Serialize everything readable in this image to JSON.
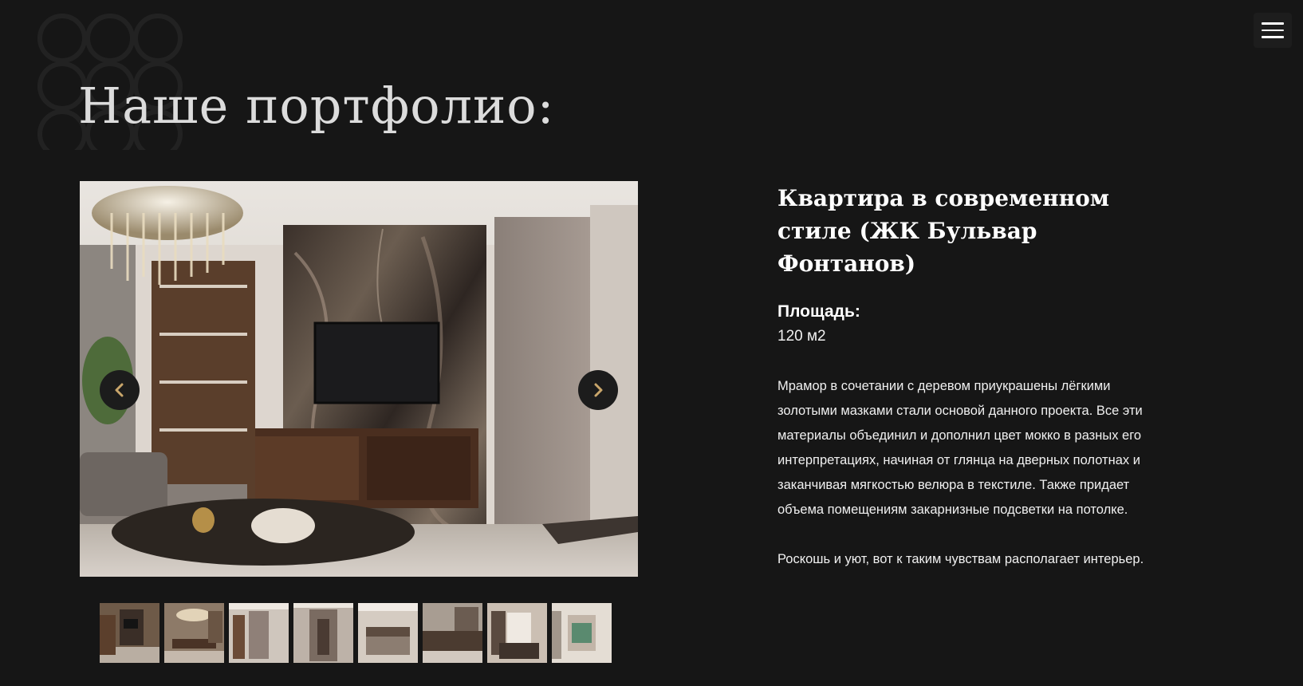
{
  "header": {
    "menu_icon": "hamburger-menu-icon"
  },
  "page_title": "Наше портфолио:",
  "gallery": {
    "prev_icon": "chevron-left-icon",
    "next_icon": "chevron-right-icon",
    "main_image": "living-room-marble-wall-photo",
    "thumbnails": [
      "living-room-photo",
      "dining-room-photo",
      "hallway-photo",
      "corridor-photo",
      "bedroom-photo",
      "kitchen-photo",
      "bedroom-window-photo",
      "bathroom-photo"
    ]
  },
  "project": {
    "title": "Квартира в современном стиле (ЖК Бульвар Фонтанов)",
    "area_label": "Площадь:",
    "area_value": "120 м2",
    "description_1": "Мрамор в сочетании с деревом приукрашены лёгкими золотыми мазками стали основой данного проекта. Все эти материалы объединил и дополнил цвет мокко в разных его интерпретациях, начиная от глянца на дверных полотнах и заканчивая мягкостью велюра в текстиле. Также придает объема помещениям закарнизные подсветки на потолке.",
    "description_2": "Роскошь и уют, вот к таким чувствам располагает интерьер."
  },
  "colors": {
    "background": "#161616",
    "text": "#ffffff",
    "title": "#dcdcdc",
    "arrow_bg": "#1c1c1c"
  }
}
